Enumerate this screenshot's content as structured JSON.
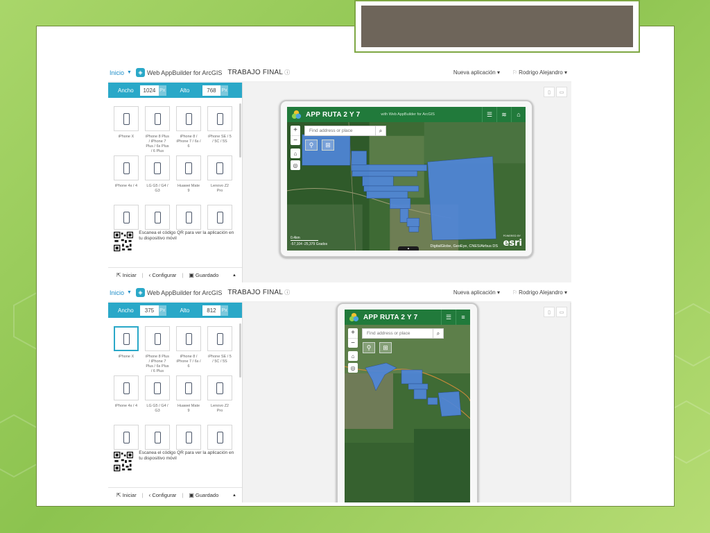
{
  "colors": {
    "slide_green": "#8cc34f",
    "builder_accent": "#2aa8c8",
    "app_header": "#217a3b",
    "parcel_fill": "#4f86d9",
    "title_box": "#6e655a"
  },
  "builder_panels": [
    {
      "topbar": {
        "inicio": "Inicio",
        "product": "Web AppBuilder for ArcGIS",
        "project": "TRABAJO FINAL",
        "info_icon": "info-icon",
        "nueva": "Nueva aplicación ▾",
        "user": "Rodrigo Alejandro ▾"
      },
      "dims": {
        "ancho_label": "Ancho",
        "ancho": "1024",
        "alto_label": "Alto",
        "alto": "768",
        "unit": "Px"
      },
      "devices": [
        [
          "iPhone X",
          "iPhone 8 Plus / iPhone 7 Plus / 6s Plus / 6 Plus",
          "iPhone 8 / iPhone 7 / 6s / 6",
          "iPhone SE / 5 / 5C / 5S"
        ],
        [
          "iPhone 4s / 4",
          "LG G5 / G4 / G3",
          "Huawei Mate 9",
          "Lenovo Z2 Pro"
        ],
        [
          "",
          "",
          "",
          ""
        ]
      ],
      "selected_device": "",
      "qr_text": "Escanea el código QR para ver la aplicación en tu dispositivo móvil",
      "bottombar": {
        "iniciar": "Iniciar",
        "configurar": "Configurar",
        "guardado": "Guardado"
      },
      "app": {
        "title": "APP RUTA 2 Y 7",
        "subtitle": "with Web AppBuilder for ArcGIS",
        "search_placeholder": "Find address or place",
        "scale": "0.4km",
        "coords": "-57,104 -25,379 Grados",
        "attribution": "DigitalGlobe, GeoEye, CNES/Airbus DS",
        "esri": "esri",
        "powered": "POWERED BY"
      }
    },
    {
      "topbar": {
        "inicio": "Inicio",
        "product": "Web AppBuilder for ArcGIS",
        "project": "TRABAJO FINAL",
        "info_icon": "info-icon",
        "nueva": "Nueva aplicación ▾",
        "user": "Rodrigo Alejandro ▾"
      },
      "dims": {
        "ancho_label": "Ancho",
        "ancho": "375",
        "alto_label": "Alto",
        "alto": "812",
        "unit": "Px"
      },
      "devices": [
        [
          "iPhone X",
          "iPhone 8 Plus / iPhone 7 Plus / 6s Plus / 6 Plus",
          "iPhone 8 / iPhone 7 / 6s / 6",
          "iPhone SE / 5 / 5C / 5S"
        ],
        [
          "iPhone 4s / 4",
          "LG G5 / G4 / G3",
          "Huawei Mate 9",
          "Lenovo Z2 Pro"
        ],
        [
          "",
          "",
          "",
          ""
        ]
      ],
      "selected_device": "iPhone X",
      "qr_text": "Escanea el código QR para ver la aplicación en tu dispositivo móvil",
      "bottombar": {
        "iniciar": "Iniciar",
        "configurar": "Configurar",
        "guardado": "Guardado"
      },
      "app": {
        "title": "APP RUTA 2 Y 7",
        "search_placeholder": "Find address or place"
      }
    }
  ]
}
